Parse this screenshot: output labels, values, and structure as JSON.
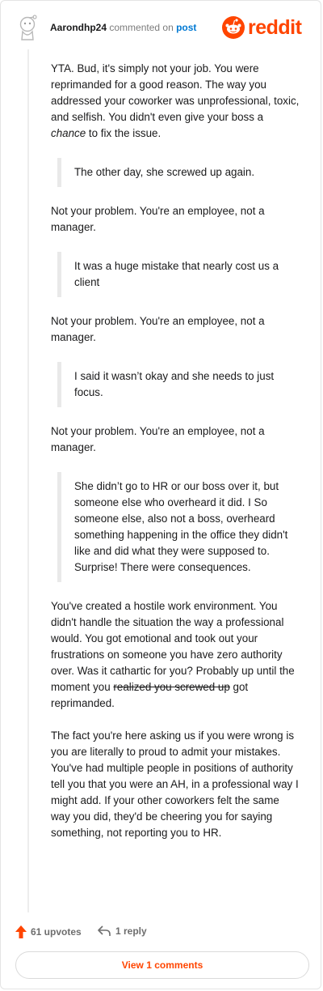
{
  "header": {
    "username": "Aarondhp24",
    "action_text": "commented on",
    "post_link": "post",
    "logo_text": "reddit",
    "brand_color": "#ff4500"
  },
  "comment": {
    "p1_a": "YTA. Bud, it's simply not your job. You were reprimanded for a good reason. The way you addressed your coworker was unprofessional, toxic, and selfish. You didn't even give your boss a ",
    "p1_em": "chance",
    "p1_b": " to fix the issue.",
    "quote1": "The other day, she screwed up again.",
    "reply1": "Not your problem. You're an employee, not a manager.",
    "quote2": "It was a huge mistake that nearly cost us a client",
    "reply2": "Not your problem. You're an employee, not a manager.",
    "quote3": "I said it wasn’t okay and she needs to just focus.",
    "reply3": "Not your problem. You're an employee, not a manager.",
    "quote4": "She didn’t go to HR or our boss over it, but someone else who overheard it did. I So someone else, also not a boss, overheard something happening in the office they didn't like and did what they were supposed to. Surprise! There were consequences.",
    "p5_a": "You've created a hostile work environment. You didn't handle the situation the way a professional would. You got emotional and took out your frustrations on someone you have zero authority over. Was it cathartic for you? Probably up until the moment you ",
    "p5_strike": "realized you screwed up",
    "p5_b": " got reprimanded.",
    "p6": "The fact you're here asking us if you were wrong is you are literally to proud to admit your mistakes. You've had multiple people in positions of authority tell you that you were an AH, in a professional way I might add. If your other coworkers felt the same way you did, they'd be cheering you for saying something, not reporting you to HR."
  },
  "footer": {
    "upvotes": "61 upvotes",
    "replies": "1 reply",
    "view_comments": "View 1 comments",
    "upvote_icon": "upvote-arrow-icon",
    "reply_icon": "reply-arrow-icon"
  }
}
